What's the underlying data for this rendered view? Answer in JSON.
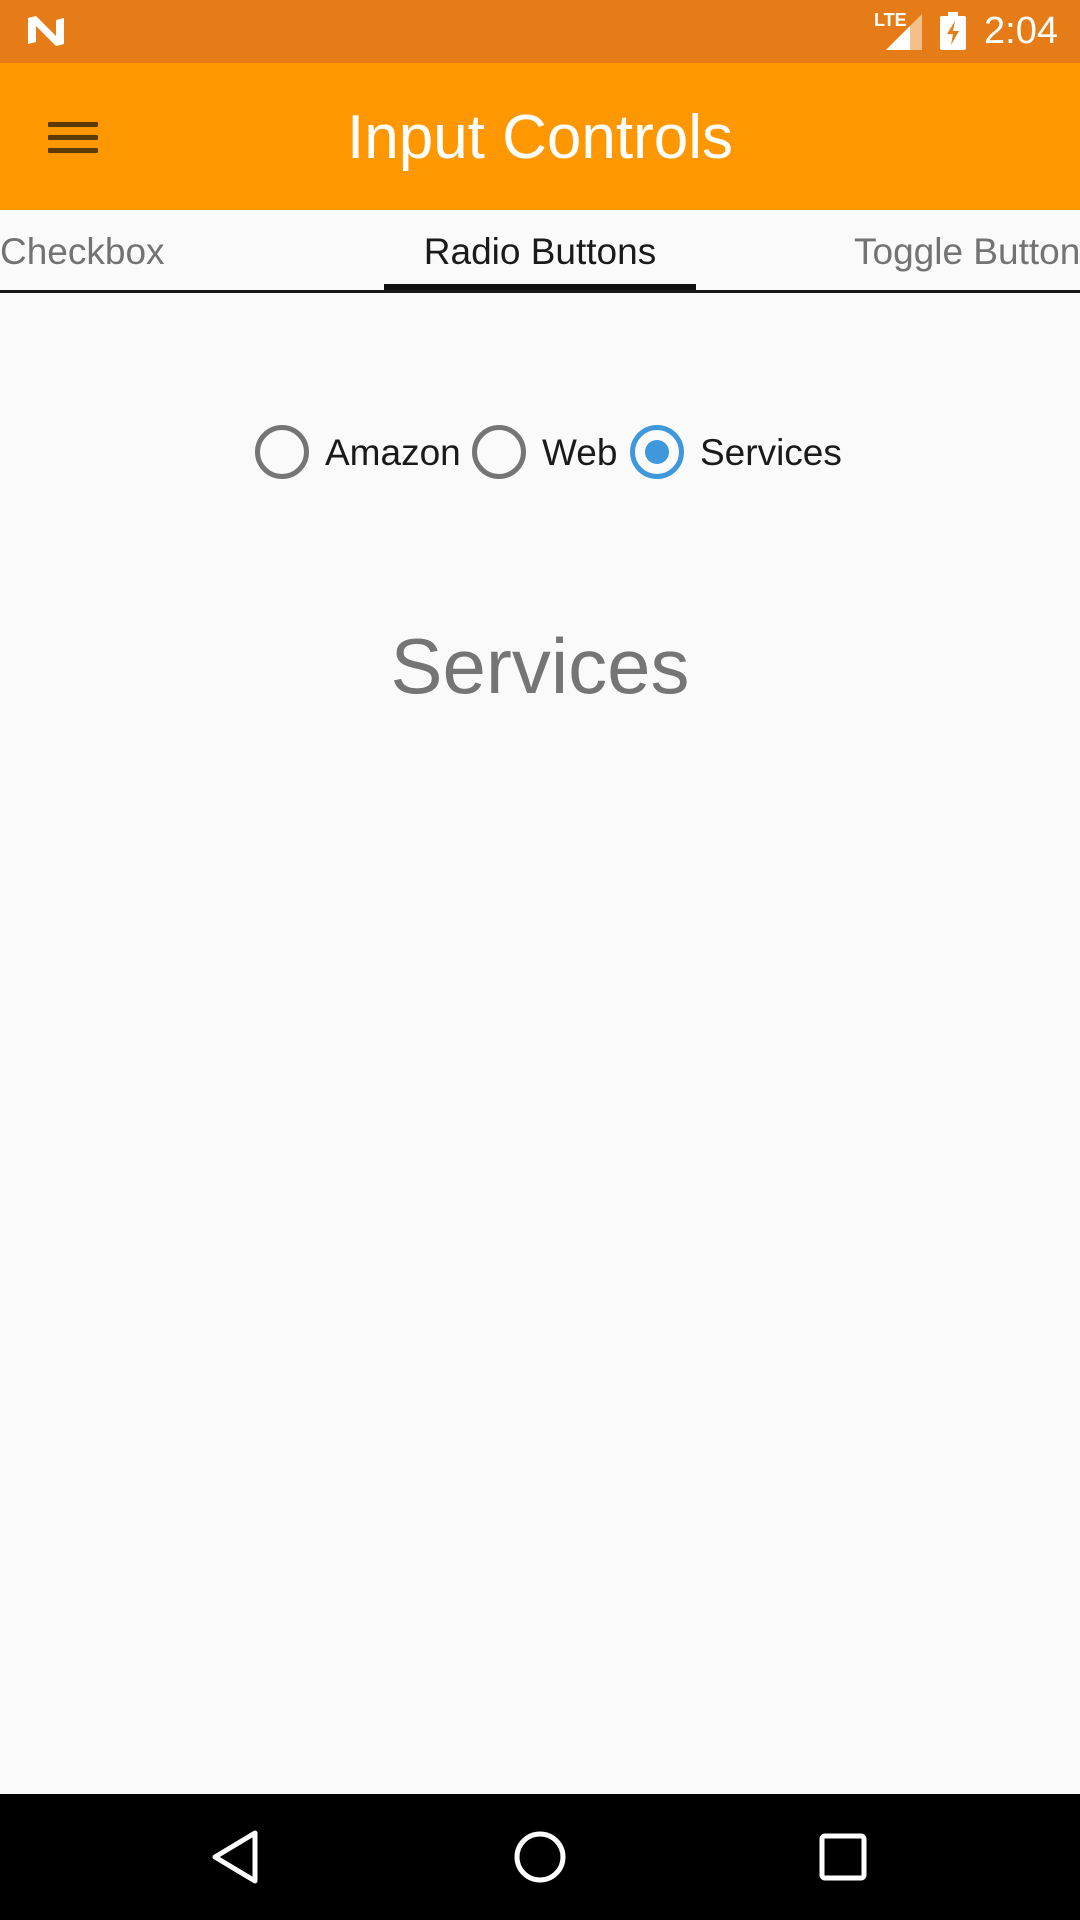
{
  "status_bar": {
    "network": "LTE",
    "time": "2:04",
    "icons": [
      "n-logo-icon",
      "signal-icon",
      "battery-charging-icon"
    ]
  },
  "app_bar": {
    "title": "Input Controls",
    "menu_icon": "hamburger-menu-icon"
  },
  "tabs": [
    {
      "label": "Checkbox",
      "active": false
    },
    {
      "label": "Radio Buttons",
      "active": true
    },
    {
      "label": "Toggle Button",
      "active": false
    }
  ],
  "radio_group": {
    "options": [
      {
        "label": "Amazon",
        "checked": false
      },
      {
        "label": "Web",
        "checked": false
      },
      {
        "label": "Services",
        "checked": true
      }
    ]
  },
  "selected_value": "Services",
  "nav_bar": {
    "icons": [
      "back-icon",
      "home-icon",
      "recents-icon"
    ]
  },
  "colors": {
    "status_bar": "#e57c17",
    "app_bar": "#ff9800",
    "radio_accent": "#3f98dc",
    "background": "#fafafa"
  }
}
